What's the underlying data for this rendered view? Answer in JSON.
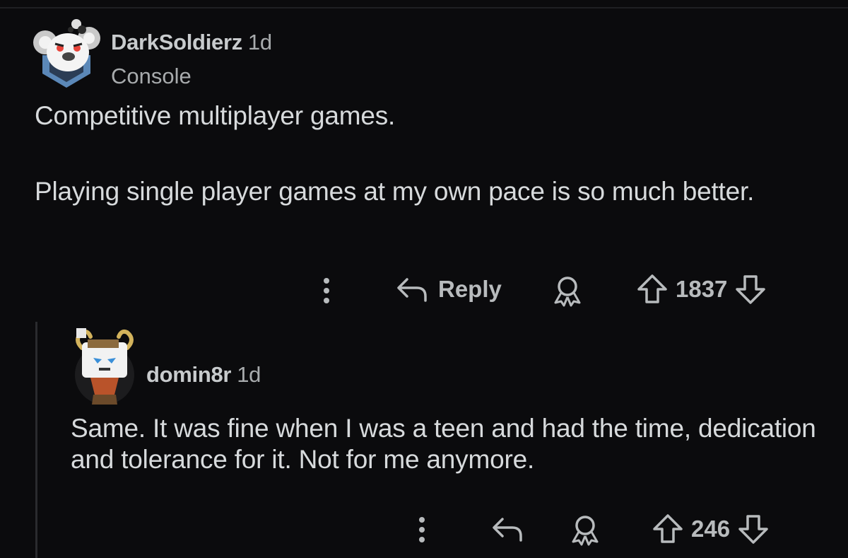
{
  "comments": [
    {
      "username": "DarkSoldierz",
      "age": "1d",
      "flair": "Console",
      "body": [
        "Competitive multiplayer games.",
        "Playing single player games at my own pace is so much better."
      ],
      "reply_label": "Reply",
      "score": "1837",
      "avatar_icon": "koala-avatar-icon"
    },
    {
      "username": "domin8r",
      "age": "1d",
      "body": [
        "Same. It was fine when I was a teen and had the time, dedication and tolerance for it. Not for me anymore."
      ],
      "reply_label": "",
      "score": "246",
      "avatar_icon": "horned-robot-avatar-icon"
    }
  ],
  "colors": {
    "background": "#0b0b0d",
    "text": "#d7dadc",
    "meta": "#a8abad",
    "icon": "#b8bbbd",
    "thread_line": "#2a2b2e"
  }
}
